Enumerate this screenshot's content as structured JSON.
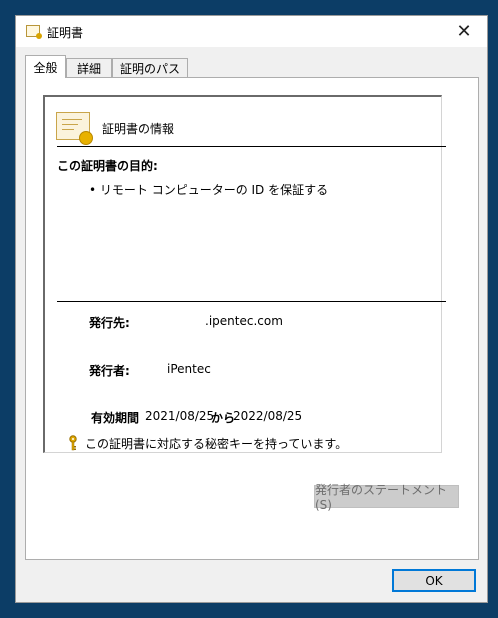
{
  "window": {
    "title": "証明書",
    "close_glyph": "✕"
  },
  "tabs": [
    {
      "label": "全般",
      "active": true
    },
    {
      "label": "詳細",
      "active": false
    },
    {
      "label": "証明のパス",
      "active": false
    }
  ],
  "general": {
    "info_heading": "証明書の情報",
    "purpose_heading": "この証明書の目的:",
    "purpose_items": [
      "• リモート コンピューターの ID を保証する"
    ],
    "issued_to_label": "発行先:",
    "issued_to_value": ".ipentec.com",
    "issued_by_label": "発行者:",
    "issued_by_value": "iPentec",
    "validity_label": "有効期間",
    "valid_from": "2021/08/25",
    "validity_connector": "から",
    "valid_to": "2022/08/25",
    "private_key_note": "この証明書に対応する秘密キーを持っています。"
  },
  "buttons": {
    "issuer_statement": "発行者のステートメント(S)",
    "ok": "OK"
  },
  "colors": {
    "desktop": "#0c3d66",
    "ok_focus": "#0078d7",
    "cert_gold": "#e8b100"
  },
  "icons": {
    "window_icon": "certificate-icon",
    "header_icon": "certificate-icon",
    "key": "key-icon"
  }
}
